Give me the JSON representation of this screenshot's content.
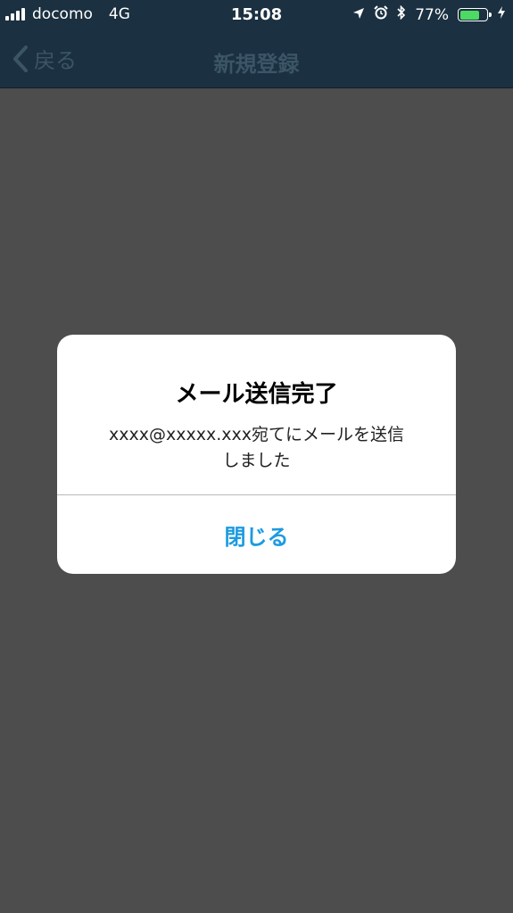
{
  "status_bar": {
    "carrier": "docomo",
    "network": "4G",
    "time": "15:08",
    "battery_percent": "77%",
    "battery_level": 0.77,
    "icons": [
      "signal-icon",
      "location-icon",
      "alarm-icon",
      "bluetooth-icon",
      "battery-icon",
      "charging-icon"
    ]
  },
  "nav": {
    "back_label": "戻る",
    "title": "新規登録"
  },
  "alert": {
    "title": "メール送信完了",
    "message_line1": "xxxx@xxxxx.xxx宛てにメールを送信",
    "message_line2": "しました",
    "button_label": "閉じる"
  },
  "colors": {
    "nav_background": "#1b3040",
    "dim_background": "#4d4d4d",
    "alert_button": "#1c9be0",
    "battery_fill": "#4cd964"
  }
}
